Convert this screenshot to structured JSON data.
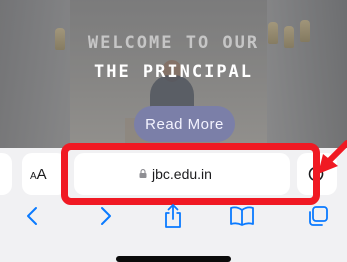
{
  "hero": {
    "welcome_text": "WELCOME TO OUR",
    "title": "THE PRINCIPAL",
    "button_label": "Read More"
  },
  "browser": {
    "text_size_label_small": "A",
    "text_size_label_large": "A",
    "url": "jbc.edu.in"
  },
  "colors": {
    "accent": "#0a7aff",
    "highlight": "#f01923",
    "button": "#7b7fa8"
  },
  "icons": [
    "lock-icon",
    "reload-icon",
    "back-icon",
    "forward-icon",
    "share-icon",
    "bookmarks-icon",
    "tabs-icon"
  ]
}
